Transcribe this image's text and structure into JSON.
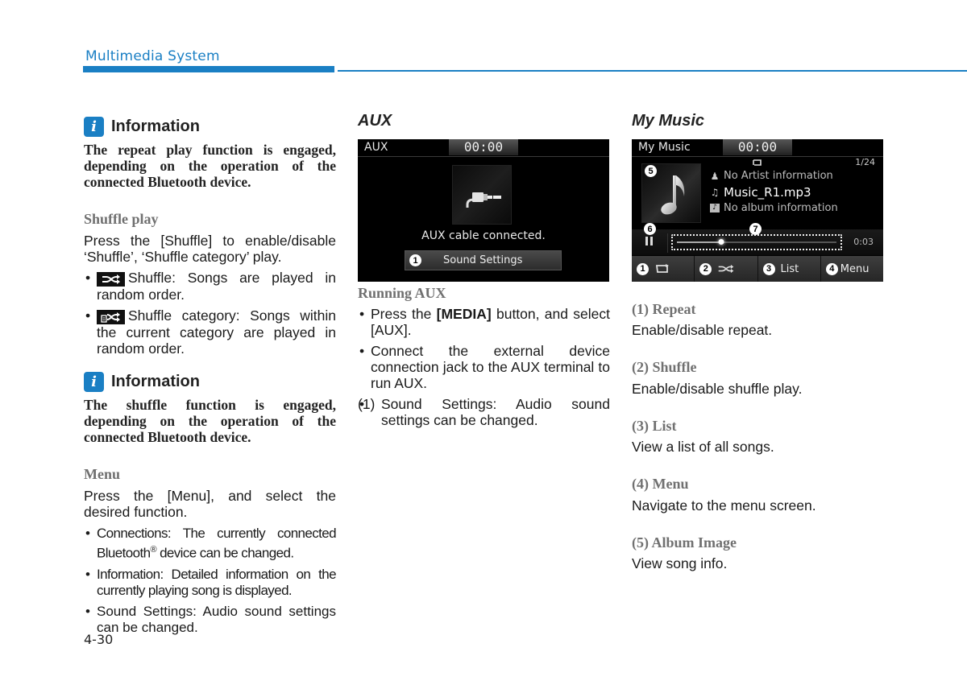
{
  "header": {
    "title": "Multimedia System"
  },
  "col1": {
    "info1": {
      "label": "Information",
      "text": "The repeat play function is engaged, depending on the operation of the connected Bluetooth device."
    },
    "shuffle": {
      "heading": "Shuffle play",
      "intro": "Press the [Shuffle] to enable/disable ‘Shuffle’, ‘Shuffle category’ play.",
      "bullets": [
        {
          "icon": "shuffle-icon",
          "text": "Shuffle: Songs are played in random order."
        },
        {
          "icon": "shuffle-category-icon",
          "text": "Shuffle category: Songs within the current category are played in random order."
        }
      ]
    },
    "info2": {
      "label": "Information",
      "text": "The shuffle function is engaged, depending on the operation of the connected Bluetooth device."
    },
    "menu": {
      "heading": "Menu",
      "intro": "Press the [Menu], and select the desired function.",
      "bullets": [
        {
          "text_a": "Connections: The currently connected Bluetooth",
          "sup": "®",
          "text_b": " device can be changed."
        },
        {
          "text": "Information: Detailed information on the currently playing song is displayed."
        },
        {
          "text": "Sound Settings: Audio sound settings can be changed."
        }
      ]
    }
  },
  "col2": {
    "title": "AUX",
    "screen": {
      "source": "AUX",
      "time": "00:00",
      "icon": "aux-cable-icon",
      "message": "AUX cable connected.",
      "button": {
        "callout": "1",
        "label": "Sound Settings"
      }
    },
    "running": {
      "heading": "Running AUX",
      "bullets": [
        {
          "pre": "Press the ",
          "bold": "[MEDIA]",
          "post": " button, and select [AUX]."
        },
        {
          "text": "Connect the external device connection jack to the AUX terminal to run AUX."
        }
      ],
      "numbered": [
        {
          "num": "(1)",
          "text": "Sound Settings: Audio sound settings can be changed."
        }
      ]
    }
  },
  "col3": {
    "title": "My Music",
    "screen": {
      "source": "My Music",
      "time": "00:00",
      "track_count": "1/24",
      "artist": "No Artist information",
      "song": "Music_R1.mp3",
      "album": "No album information",
      "elapsed": "0:03",
      "progress_fraction": 0.28,
      "callouts": {
        "album_art": "5",
        "pause": "6",
        "seek": "7"
      },
      "buttons": [
        {
          "callout": "1",
          "icon": "repeat-icon",
          "label": ""
        },
        {
          "callout": "2",
          "icon": "shuffle-icon",
          "label": ""
        },
        {
          "callout": "3",
          "icon": "",
          "label": "List"
        },
        {
          "callout": "4",
          "icon": "",
          "label": "Menu"
        }
      ]
    },
    "items": [
      {
        "heading": "(1) Repeat",
        "text": "Enable/disable repeat."
      },
      {
        "heading": "(2) Shuffle",
        "text": "Enable/disable shuffle play."
      },
      {
        "heading": "(3) List",
        "text": "View a list of all songs."
      },
      {
        "heading": "(4) Menu",
        "text": "Navigate to the menu screen."
      },
      {
        "heading": "(5) Album Image",
        "text": "View song info."
      }
    ]
  },
  "footer": {
    "page_number": "4-30"
  },
  "colors": {
    "accent": "#1a7fc4",
    "subhead": "#707070",
    "screen_bg": "#000000"
  }
}
